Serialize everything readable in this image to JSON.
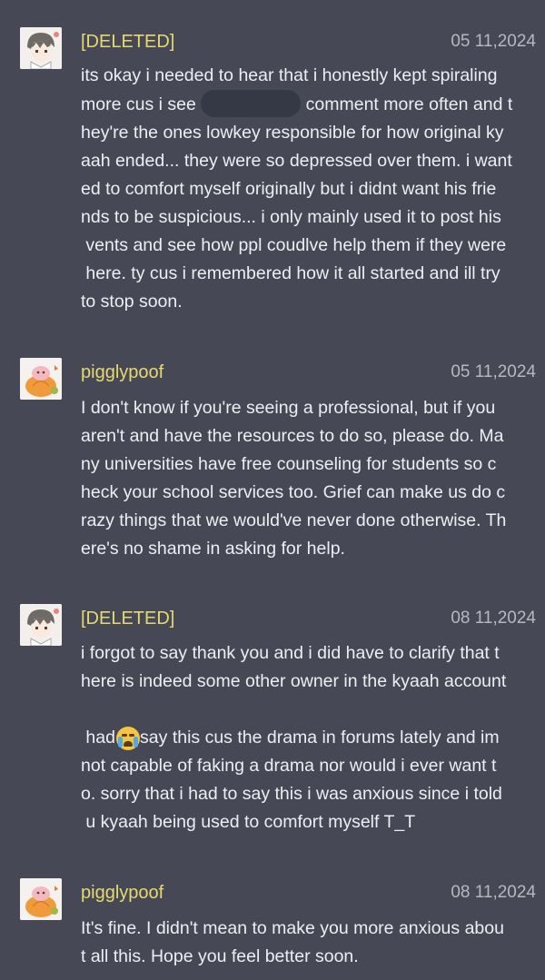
{
  "comments": [
    {
      "username": "[DELETED]",
      "date": "05 11,2024",
      "avatar": "anime-character-avatar",
      "lines": [
        "its okay i needed to hear that i honestly kept spiraling",
        "more cus i see",
        "comment more often and t",
        "hey're the ones lowkey responsible for how original ky",
        "aah ended... they were so depressed over them. i want",
        "ed to comfort myself originally but i didnt want his frie",
        "nds to be suspicious... i only mainly used it to post his",
        " vents and see how ppl coudlve help them if they were",
        " here. ty cus i remembered how it all started and ill try",
        "to stop soon."
      ]
    },
    {
      "username": "pigglypoof",
      "date": "05 11,2024",
      "avatar": "pumpkin-avatar",
      "lines": [
        "I don't know if you're seeing a professional, but if you",
        "aren't and have the resources to do so, please do. Ma",
        "ny universities have free counseling for students so c",
        "heck your school services too. Grief can make us do c",
        "razy things that we would've never done otherwise. Th",
        "ere's no shame in asking for help."
      ]
    },
    {
      "username": "[DELETED]",
      "date": "08 11,2024",
      "avatar": "anime-character-avatar",
      "lines": [
        "i forgot to say thank you and i did have to clarify that t",
        "here is indeed some other owner in the kyaah account",
        " had to say this cus the drama in forums lately and im",
        "not capable of faking a drama nor would i ever want t",
        "o. sorry that i had to say this i was anxious since i told",
        " u kyaah being used to comfort myself T_T"
      ],
      "emoji": "loudly-crying-face-emoji"
    },
    {
      "username": "pigglypoof",
      "date": "08 11,2024",
      "avatar": "pumpkin-avatar",
      "lines": [
        "It's fine. I didn't mean to make you more anxious abou",
        "t all this. Hope you feel better soon."
      ]
    }
  ],
  "colors": {
    "background": "#464856",
    "username": "#e6da6e",
    "text": "#eeeef2",
    "date": "#b6b8c1",
    "redaction": "#353945"
  }
}
